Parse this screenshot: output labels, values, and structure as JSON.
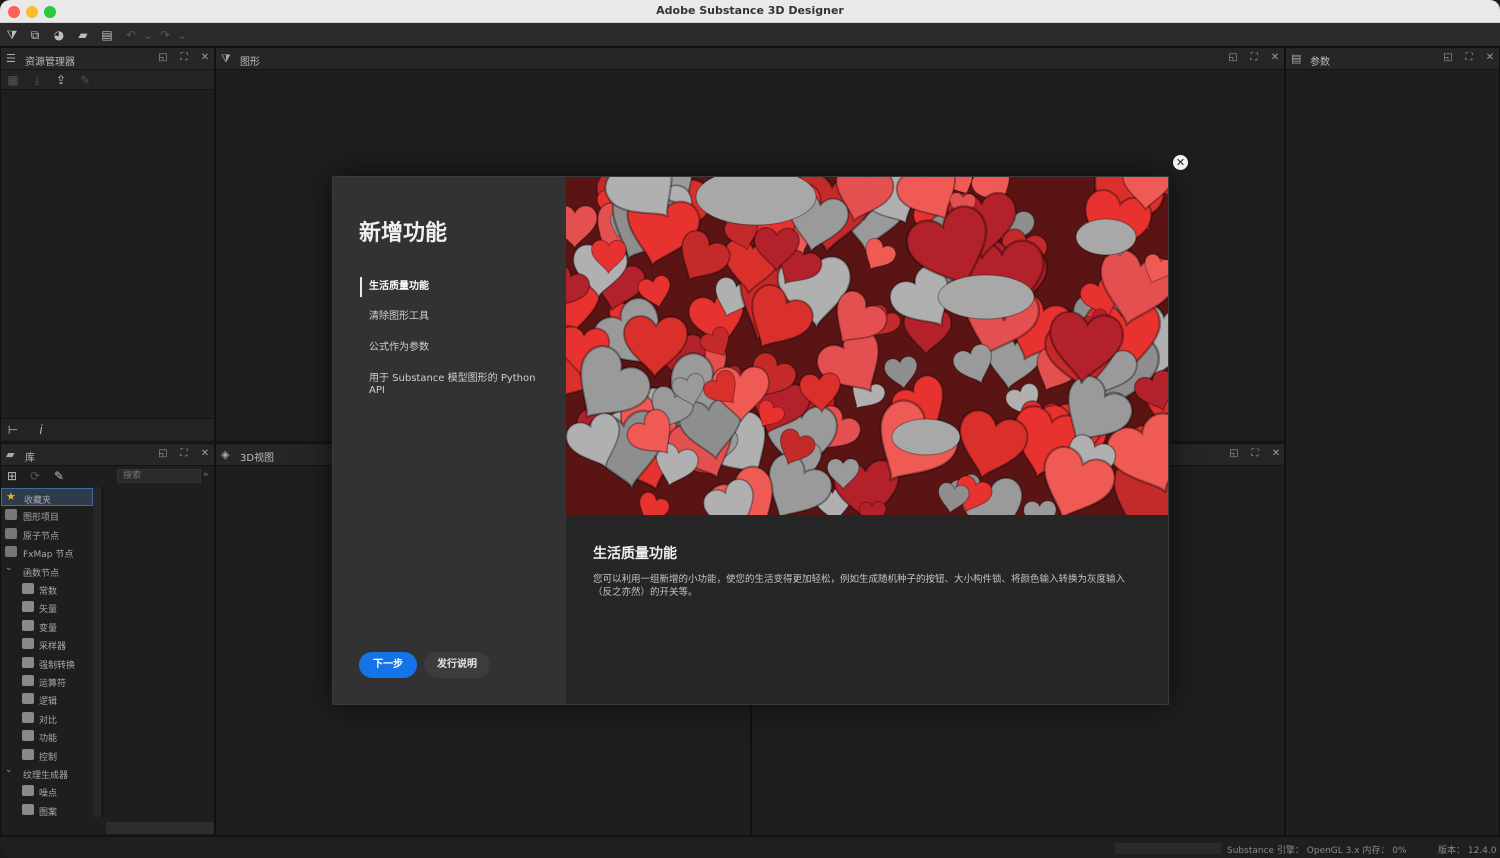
{
  "window": {
    "title": "Adobe Substance 3D Designer"
  },
  "panels": {
    "explorer": {
      "title": "资源管理器"
    },
    "graph": {
      "title": "图形"
    },
    "params": {
      "title": "参数"
    },
    "library": {
      "title": "库",
      "search_placeholder": "搜索"
    },
    "view3d": {
      "title": "3D视图"
    }
  },
  "library": {
    "items": [
      {
        "label": "收藏夹",
        "type": "top",
        "selected": true
      },
      {
        "label": "图形项目",
        "type": "top"
      },
      {
        "label": "原子节点",
        "type": "top"
      },
      {
        "label": "FxMap 节点",
        "type": "top"
      },
      {
        "label": "函数节点",
        "type": "group"
      },
      {
        "label": "常数",
        "type": "sub"
      },
      {
        "label": "矢量",
        "type": "sub"
      },
      {
        "label": "变量",
        "type": "sub"
      },
      {
        "label": "采样器",
        "type": "sub"
      },
      {
        "label": "强制转换",
        "type": "sub"
      },
      {
        "label": "运算符",
        "type": "sub"
      },
      {
        "label": "逻辑",
        "type": "sub"
      },
      {
        "label": "对比",
        "type": "sub"
      },
      {
        "label": "功能",
        "type": "sub"
      },
      {
        "label": "控制",
        "type": "sub"
      },
      {
        "label": "纹理生成器",
        "type": "group"
      },
      {
        "label": "噪点",
        "type": "sub"
      },
      {
        "label": "图案",
        "type": "sub"
      }
    ]
  },
  "dialog": {
    "heading": "新增功能",
    "nav": [
      {
        "label": "生活质量功能",
        "active": true
      },
      {
        "label": "清除图形工具",
        "active": false
      },
      {
        "label": "公式作为参数",
        "active": false
      },
      {
        "label": "用于 Substance 模型图形的 Python API",
        "active": false
      }
    ],
    "feature_title": "生活质量功能",
    "feature_desc": "您可以利用一组新增的小功能，使您的生活变得更加轻松，例如生成随机种子的按钮、大小构件锁、将颜色输入转换为灰度输入（反之亦然）的开关等。",
    "next_label": "下一步",
    "notes_label": "发行说明"
  },
  "status": {
    "engine": "Substance 引擎：  OpenGL 3.x  内存：  0%",
    "version": "版本：  12.4.0"
  },
  "colors": {
    "accent": "#1473e6",
    "close_red": "#ff5f57",
    "min_yellow": "#febc2e",
    "max_green": "#28c840"
  }
}
